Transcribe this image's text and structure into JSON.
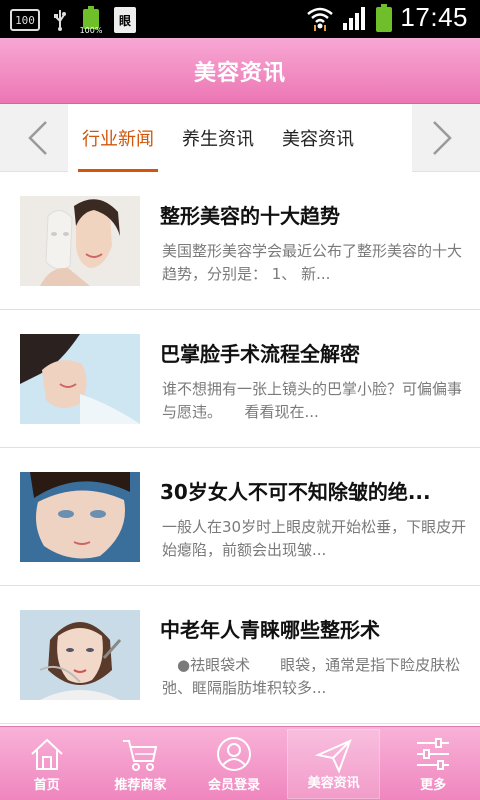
{
  "status_bar": {
    "left_box_text": "100",
    "battery_small_text": "100%",
    "doc_icon_text": "眼",
    "time": "17:45"
  },
  "header": {
    "title": "美容资讯"
  },
  "tabs": [
    {
      "label": "行业新闻",
      "active": true
    },
    {
      "label": "养生资讯",
      "active": false
    },
    {
      "label": "美容资讯",
      "active": false
    }
  ],
  "articles": [
    {
      "title": "整形美容的十大趋势",
      "summary": "美国整形美容学会最近公布了整形美容的十大趋势，分别是： 1、 新..."
    },
    {
      "title": "巴掌脸手术流程全解密",
      "summary": "谁不想拥有一张上镜头的巴掌小脸？可偏偏事与愿违。　　看看现在..."
    },
    {
      "title": "30岁女人不可不知除皱的绝...",
      "summary": "一般人在30岁时上眼皮就开始松垂，下眼皮开始瘪陷，前额会出现皱..."
    },
    {
      "title": "中老年人青睐哪些整形术",
      "summary": "　●祛眼袋术　　眼袋，通常是指下睑皮肤松弛、眶隔脂肪堆积较多..."
    }
  ],
  "bottom_nav": [
    {
      "label": "首页",
      "icon": "home-icon",
      "active": false
    },
    {
      "label": "推荐商家",
      "icon": "cart-icon",
      "active": false
    },
    {
      "label": "会员登录",
      "icon": "user-icon",
      "active": false
    },
    {
      "label": "美容资讯",
      "icon": "paper-plane-icon",
      "active": true
    },
    {
      "label": "更多",
      "icon": "sliders-icon",
      "active": false
    }
  ],
  "colors": {
    "header_pink": "#ec76b4",
    "active_tab": "#d2560a",
    "status_green": "#6fbf2a"
  }
}
